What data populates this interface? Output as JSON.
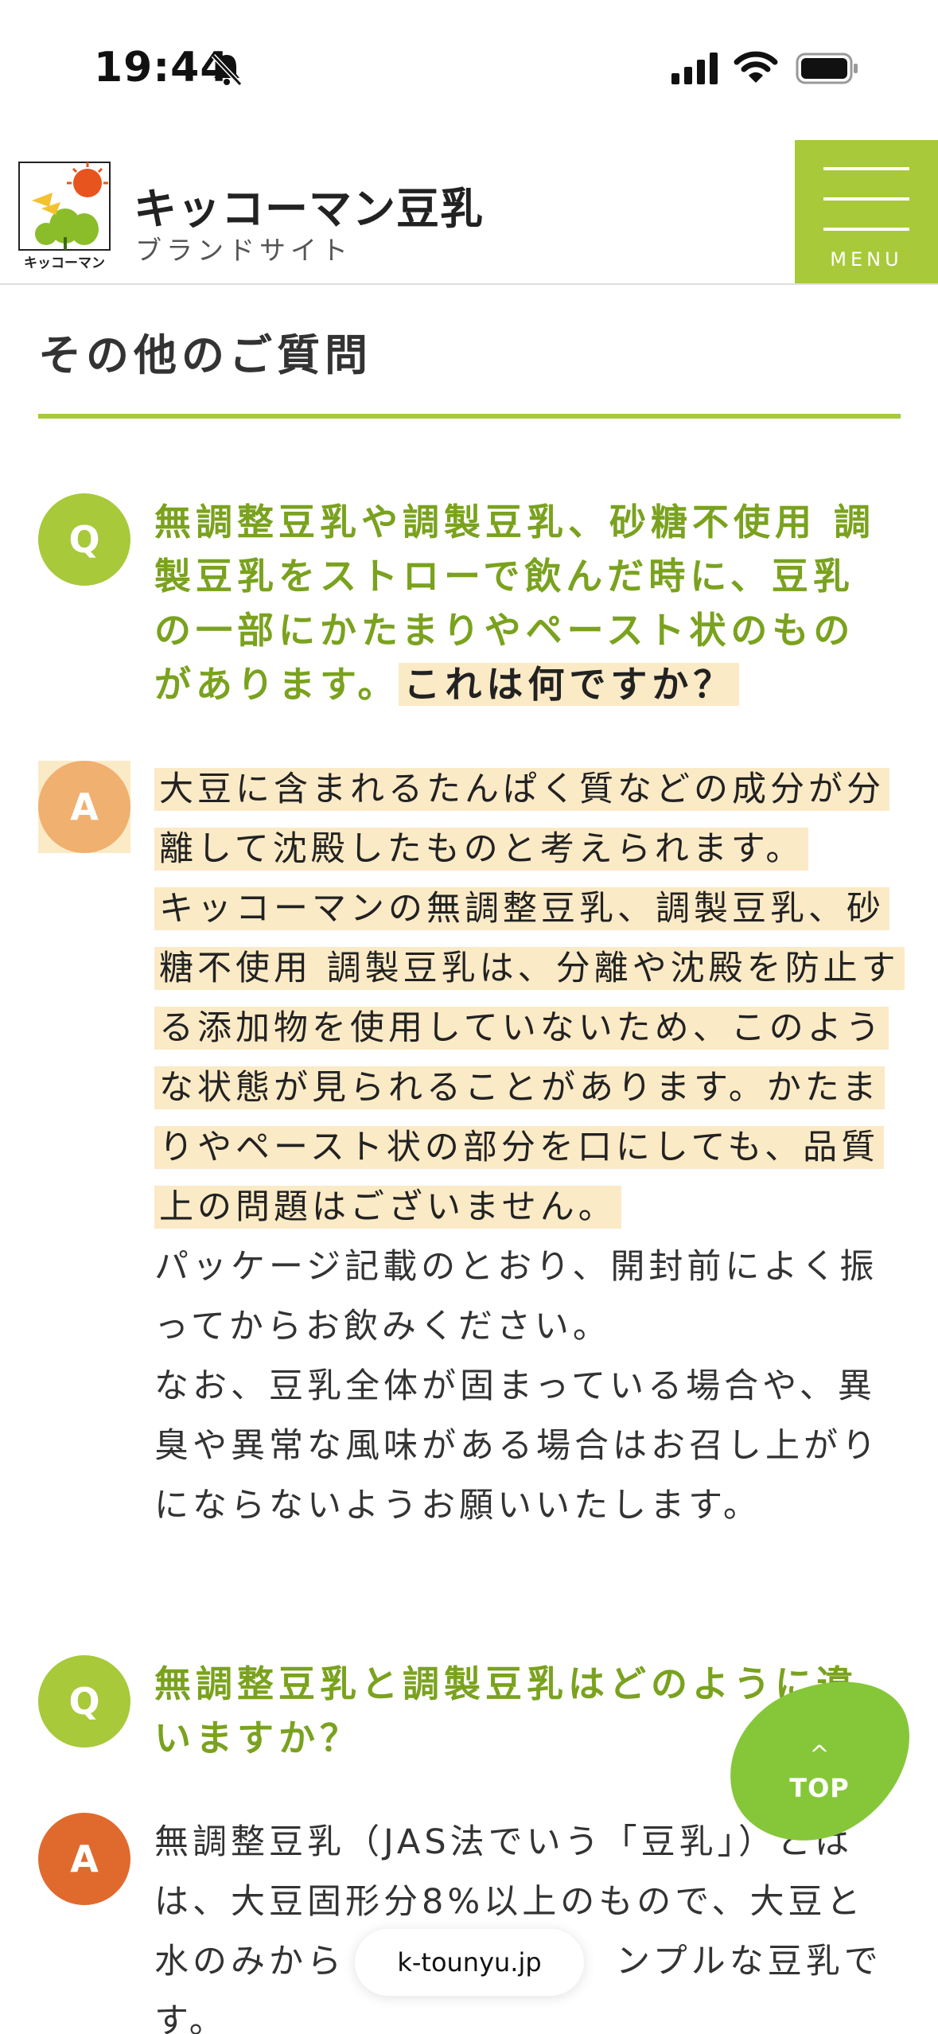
{
  "status_bar": {
    "time": "19:44"
  },
  "header": {
    "logo_caption": "キッコーマン",
    "brand_title": "キッコーマン豆乳",
    "brand_subtitle": "ブランドサイト",
    "menu_label": "MENU"
  },
  "section": {
    "title": "その他のご質問"
  },
  "faqs": [
    {
      "q_badge": "Q",
      "a_badge": "A",
      "question_lines": [
        "無調整豆乳や調製豆乳、砂糖不使用 調",
        "製豆乳をストローで飲んだ時に、豆乳",
        "の一部にかたまりやペースト状のもの",
        "があります。",
        "これは何ですか？"
      ],
      "answer_lines": [
        "大豆に含まれるたんぱく質などの成分が分",
        "離して沈殿したものと考えられます。",
        "キッコーマンの無調整豆乳、調製豆乳、砂",
        "糖不使用 調製豆乳は、分離や沈殿を防止す",
        "る添加物を使用していないため、このよう",
        "な状態が見られることがあります。かたま",
        "りやペースト状の部分を口にしても、品質",
        "上の問題はございません。",
        "パッケージ記載のとおり、開封前によく振",
        "ってからお飲みください。",
        "なお、豆乳全体が固まっている場合や、異",
        "臭や異常な風味がある場合はお召し上がり",
        "にならないようお願いいたします。"
      ]
    },
    {
      "q_badge": "Q",
      "a_badge": "A",
      "question_lines": [
        "無調整豆乳と調製豆乳はどのように違",
        "いますか？"
      ],
      "answer_lines": [
        "無調整豆乳（JAS法でいう「豆乳」）とは",
        "は、大豆固形分8%以上のもので、大豆と",
        "水のみから",
        "ンプルな豆乳で",
        "す。"
      ]
    }
  ],
  "top_button": {
    "caret": "^",
    "label": "TOP"
  },
  "browser": {
    "url": "k-tounyu.jp"
  },
  "colors": {
    "accent_green": "#a8c93a",
    "question_green": "#7aa21e",
    "answer_orange": "#e06a2e",
    "highlight": "#fbeac6"
  }
}
